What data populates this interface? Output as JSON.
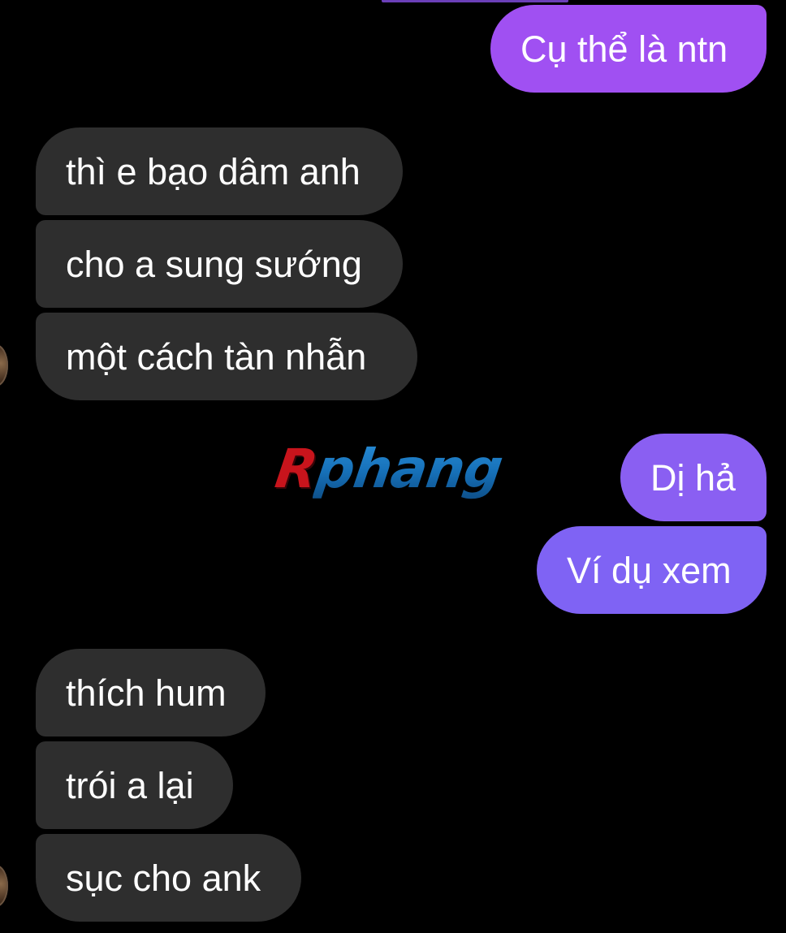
{
  "conversation": {
    "messages": [
      {
        "direction": "sent",
        "text": "Cụ thể là ntn"
      },
      {
        "direction": "received",
        "text": "thì e bạo dâm anh"
      },
      {
        "direction": "received",
        "text": "cho a sung sướng"
      },
      {
        "direction": "received",
        "text": "một cách tàn nhẫn"
      },
      {
        "direction": "sent",
        "text": "Dị hả"
      },
      {
        "direction": "sent",
        "text": "Ví dụ xem"
      },
      {
        "direction": "received",
        "text": "thích hum"
      },
      {
        "direction": "received",
        "text": "trói a lại"
      },
      {
        "direction": "received",
        "text": "sục cho ank"
      }
    ]
  },
  "watermark": {
    "first_letter": "R",
    "rest": "phang"
  },
  "colors": {
    "background": "#000000",
    "received_bubble": "#2e2e2e",
    "sent_bubble_top": "#a050f2",
    "sent_bubble_mid": "#8a5ff2",
    "sent_bubble_bottom": "#7f63f4",
    "text": "#ffffff"
  }
}
